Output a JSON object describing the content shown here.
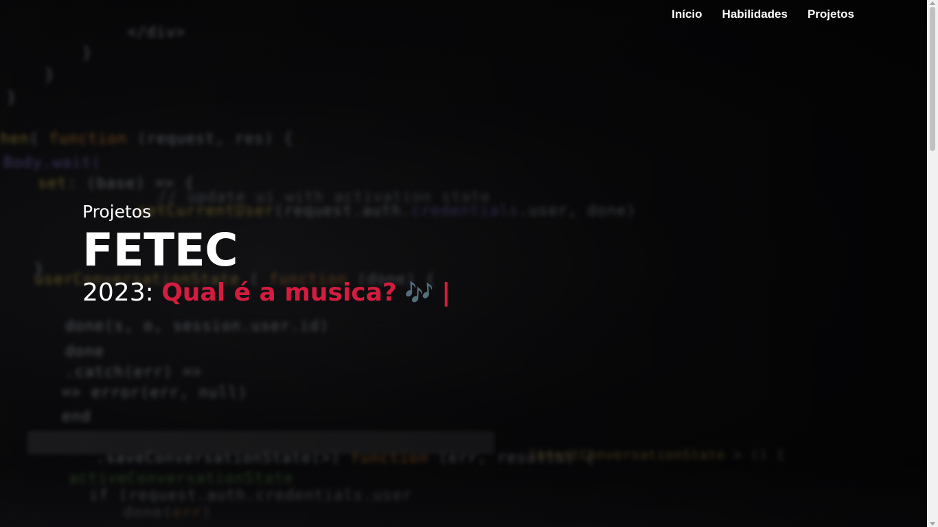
{
  "nav": {
    "items": [
      {
        "label": "Início"
      },
      {
        "label": "Habilidades"
      },
      {
        "label": "Projetos"
      }
    ]
  },
  "hero": {
    "kicker": "Projetos",
    "title": "FETEC",
    "subtitle_prefix": "2023: ",
    "subtitle_accent": "Qual é a musica?",
    "subtitle_emoji": "🎶",
    "cursor": "|"
  },
  "colors": {
    "accent": "#d41c3f",
    "text": "#ffffff",
    "background": "#050506"
  }
}
